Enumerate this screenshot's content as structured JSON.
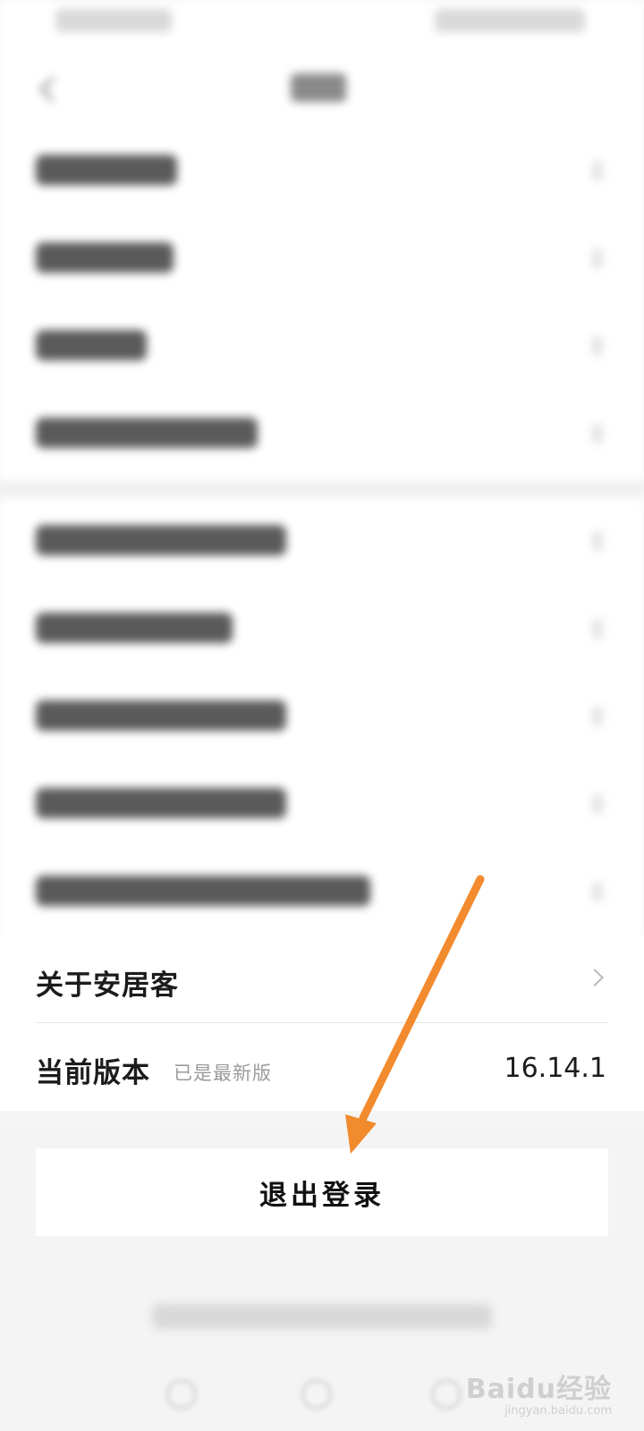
{
  "screen": {
    "background": "#f5f5f5"
  },
  "menu": {
    "about": {
      "label": "关于安居客"
    },
    "version": {
      "label": "当前版本",
      "status": "已是最新版",
      "value": "16.14.1"
    }
  },
  "logout": {
    "label": "退出登录"
  },
  "watermark": {
    "main": "Baidu经验",
    "sub": "jingyan.baidu.com"
  },
  "annotation": {
    "arrow_color": "#f28a2e"
  }
}
